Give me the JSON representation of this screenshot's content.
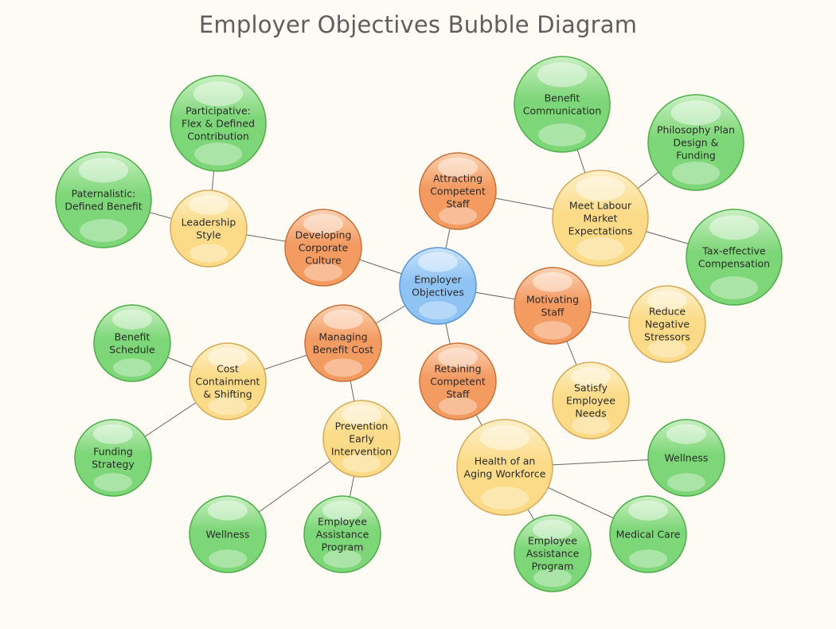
{
  "title": "Employer Objectives Bubble Diagram",
  "palette": {
    "blue": {
      "fill": "#8ec3f4",
      "light": "#c9e2fb",
      "stroke": "#5a97d6"
    },
    "orange": {
      "fill": "#f49b62",
      "light": "#fbd2b2",
      "stroke": "#c9713a"
    },
    "yellow": {
      "fill": "#fbdb88",
      "light": "#fdf0c9",
      "stroke": "#d7aa58"
    },
    "green": {
      "fill": "#7dd677",
      "light": "#c9f0c2",
      "stroke": "#4fae4a"
    }
  },
  "nodes": [
    {
      "id": "employer-objectives",
      "label": [
        "Employer",
        "Objectives"
      ],
      "color": "blue",
      "level": "root"
    },
    {
      "id": "attracting-competent-staff",
      "label": [
        "Attracting",
        "Competent",
        "Staff"
      ],
      "color": "orange",
      "level": "primary"
    },
    {
      "id": "developing-corporate-culture",
      "label": [
        "Developing",
        "Corporate",
        "Culture"
      ],
      "color": "orange",
      "level": "primary"
    },
    {
      "id": "managing-benefit-cost",
      "label": [
        "Managing",
        "Benefit Cost"
      ],
      "color": "orange",
      "level": "primary"
    },
    {
      "id": "motivating-staff",
      "label": [
        "Motivating",
        "Staff"
      ],
      "color": "orange",
      "level": "primary"
    },
    {
      "id": "retaining-competent-staff",
      "label": [
        "Retaining",
        "Competent",
        "Staff"
      ],
      "color": "orange",
      "level": "primary"
    },
    {
      "id": "leadership-style",
      "label": [
        "Leadership",
        "Style"
      ],
      "color": "yellow",
      "level": "secondary"
    },
    {
      "id": "meet-labour-market-expectations",
      "label": [
        "Meet Labour",
        "Market",
        "Expectations"
      ],
      "color": "yellow",
      "level": "secondary"
    },
    {
      "id": "cost-containment-shifting",
      "label": [
        "Cost",
        "Containment",
        "& Shifting"
      ],
      "color": "yellow",
      "level": "secondary"
    },
    {
      "id": "prevention-early-intervention",
      "label": [
        "Prevention",
        "Early",
        "Intervention"
      ],
      "color": "yellow",
      "level": "secondary"
    },
    {
      "id": "reduce-negative-stressors",
      "label": [
        "Reduce",
        "Negative",
        "Stressors"
      ],
      "color": "yellow",
      "level": "secondary"
    },
    {
      "id": "satisfy-employee-needs",
      "label": [
        "Satisfy",
        "Employee",
        "Needs"
      ],
      "color": "yellow",
      "level": "secondary"
    },
    {
      "id": "health-of-aging-workforce",
      "label": [
        "Health of an",
        "Aging Workforce"
      ],
      "color": "yellow",
      "level": "secondary"
    },
    {
      "id": "participative",
      "label": [
        "Participative:",
        "Flex & Defined",
        "Contribution"
      ],
      "color": "green",
      "level": "tertiary"
    },
    {
      "id": "paternalistic",
      "label": [
        "Paternalistic:",
        "Defined Benefit"
      ],
      "color": "green",
      "level": "tertiary"
    },
    {
      "id": "benefit-communication",
      "label": [
        "Benefit",
        "Communication"
      ],
      "color": "green",
      "level": "tertiary"
    },
    {
      "id": "philosophy-plan-design-funding",
      "label": [
        "Philosophy Plan",
        "Design &",
        "Funding"
      ],
      "color": "green",
      "level": "tertiary"
    },
    {
      "id": "tax-effective-compensation",
      "label": [
        "Tax-effective",
        "Compensation"
      ],
      "color": "green",
      "level": "tertiary"
    },
    {
      "id": "benefit-schedule",
      "label": [
        "Benefit",
        "Schedule"
      ],
      "color": "green",
      "level": "tertiary"
    },
    {
      "id": "funding-strategy",
      "label": [
        "Funding",
        "Strategy"
      ],
      "color": "green",
      "level": "tertiary"
    },
    {
      "id": "wellness-prevention",
      "label": [
        "Wellness"
      ],
      "color": "green",
      "level": "tertiary"
    },
    {
      "id": "employee-assistance-program-prevention",
      "label": [
        "Employee",
        "Assistance",
        "Program"
      ],
      "color": "green",
      "level": "tertiary"
    },
    {
      "id": "wellness-health",
      "label": [
        "Wellness"
      ],
      "color": "green",
      "level": "tertiary"
    },
    {
      "id": "medical-care",
      "label": [
        "Medical Care"
      ],
      "color": "green",
      "level": "tertiary"
    },
    {
      "id": "employee-assistance-program-health",
      "label": [
        "Employee",
        "Assistance",
        "Program"
      ],
      "color": "green",
      "level": "tertiary"
    }
  ],
  "edges": [
    [
      "employer-objectives",
      "attracting-competent-staff"
    ],
    [
      "employer-objectives",
      "developing-corporate-culture"
    ],
    [
      "employer-objectives",
      "managing-benefit-cost"
    ],
    [
      "employer-objectives",
      "motivating-staff"
    ],
    [
      "employer-objectives",
      "retaining-competent-staff"
    ],
    [
      "developing-corporate-culture",
      "leadership-style"
    ],
    [
      "leadership-style",
      "participative"
    ],
    [
      "leadership-style",
      "paternalistic"
    ],
    [
      "attracting-competent-staff",
      "meet-labour-market-expectations"
    ],
    [
      "meet-labour-market-expectations",
      "benefit-communication"
    ],
    [
      "meet-labour-market-expectations",
      "philosophy-plan-design-funding"
    ],
    [
      "meet-labour-market-expectations",
      "tax-effective-compensation"
    ],
    [
      "managing-benefit-cost",
      "cost-containment-shifting"
    ],
    [
      "managing-benefit-cost",
      "prevention-early-intervention"
    ],
    [
      "cost-containment-shifting",
      "benefit-schedule"
    ],
    [
      "cost-containment-shifting",
      "funding-strategy"
    ],
    [
      "prevention-early-intervention",
      "wellness-prevention"
    ],
    [
      "prevention-early-intervention",
      "employee-assistance-program-prevention"
    ],
    [
      "motivating-staff",
      "reduce-negative-stressors"
    ],
    [
      "motivating-staff",
      "satisfy-employee-needs"
    ],
    [
      "retaining-competent-staff",
      "health-of-aging-workforce"
    ],
    [
      "health-of-aging-workforce",
      "wellness-health"
    ],
    [
      "health-of-aging-workforce",
      "medical-care"
    ],
    [
      "health-of-aging-workforce",
      "employee-assistance-program-health"
    ]
  ]
}
